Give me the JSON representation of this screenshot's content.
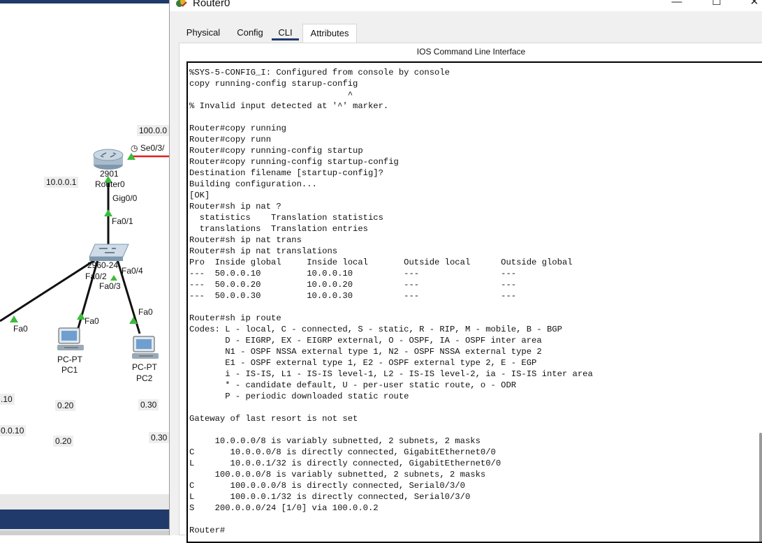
{
  "workspace": {
    "labels": {
      "ip_top": "100.0.0",
      "serial": "Se0/3/",
      "router_model": "2901",
      "router_name": "Router0",
      "router_ip": "10.0.0.1",
      "gig": "Gig0/0",
      "fa01": "Fa0/1",
      "switch_model": "2960-24",
      "fa04": "Fa0/4",
      "fa02": "Fa0/2",
      "fa03": "Fa0/3",
      "fa0_left": "Fa0",
      "fa0_pc1": "Fa0",
      "fa0_pc2": "Fa0",
      "pc1_type": "PC-PT",
      "pc1_name": "PC1",
      "pc2_type": "PC-PT",
      "pc2_name": "PC2",
      "ip_left1": ".10",
      "ip_left2": "0.0.10",
      "pc1_ip1": "0.20",
      "pc1_ip2": "0.20",
      "pc2_ip1": "0.30",
      "pc2_ip2": "0.30"
    }
  },
  "window": {
    "title": "Router0",
    "minimize": "—",
    "maximize": "☐",
    "close": "✕",
    "tabs": [
      {
        "label": "Physical"
      },
      {
        "label": "Config"
      },
      {
        "label": "CLI"
      },
      {
        "label": "Attributes"
      }
    ],
    "active_tab": "CLI",
    "cli_header": "IOS Command Line Interface",
    "cli_text": "%SYS-5-CONFIG_I: Configured from console by console\ncopy running-config starup-config\n                               ^\n% Invalid input detected at '^' marker.\n\nRouter#copy running\nRouter#copy runn\nRouter#copy running-config startup\nRouter#copy running-config startup-config\nDestination filename [startup-config]?\nBuilding configuration...\n[OK]\nRouter#sh ip nat ?\n  statistics    Translation statistics\n  translations  Translation entries\nRouter#sh ip nat trans\nRouter#sh ip nat translations\nPro  Inside global     Inside local       Outside local      Outside global\n---  50.0.0.10         10.0.0.10          ---                ---\n---  50.0.0.20         10.0.0.20          ---                ---\n---  50.0.0.30         10.0.0.30          ---                ---\n\nRouter#sh ip route\nCodes: L - local, C - connected, S - static, R - RIP, M - mobile, B - BGP\n       D - EIGRP, EX - EIGRP external, O - OSPF, IA - OSPF inter area\n       N1 - OSPF NSSA external type 1, N2 - OSPF NSSA external type 2\n       E1 - OSPF external type 1, E2 - OSPF external type 2, E - EGP\n       i - IS-IS, L1 - IS-IS level-1, L2 - IS-IS level-2, ia - IS-IS inter area\n       * - candidate default, U - per-user static route, o - ODR\n       P - periodic downloaded static route\n\nGateway of last resort is not set\n\n     10.0.0.0/8 is variably subnetted, 2 subnets, 2 masks\nC       10.0.0.0/8 is directly connected, GigabitEthernet0/0\nL       10.0.0.1/32 is directly connected, GigabitEthernet0/0\n     100.0.0.0/8 is variably subnetted, 2 subnets, 2 masks\nC       100.0.0.0/8 is directly connected, Serial0/3/0\nL       100.0.0.1/32 is directly connected, Serial0/3/0\nS    200.0.0.0/24 [1/0] via 100.0.0.2\n\nRouter#"
  },
  "colors": {
    "accent": "#1f3a6b",
    "serial_link": "#e02020",
    "link_up": "#3dbb3d"
  }
}
